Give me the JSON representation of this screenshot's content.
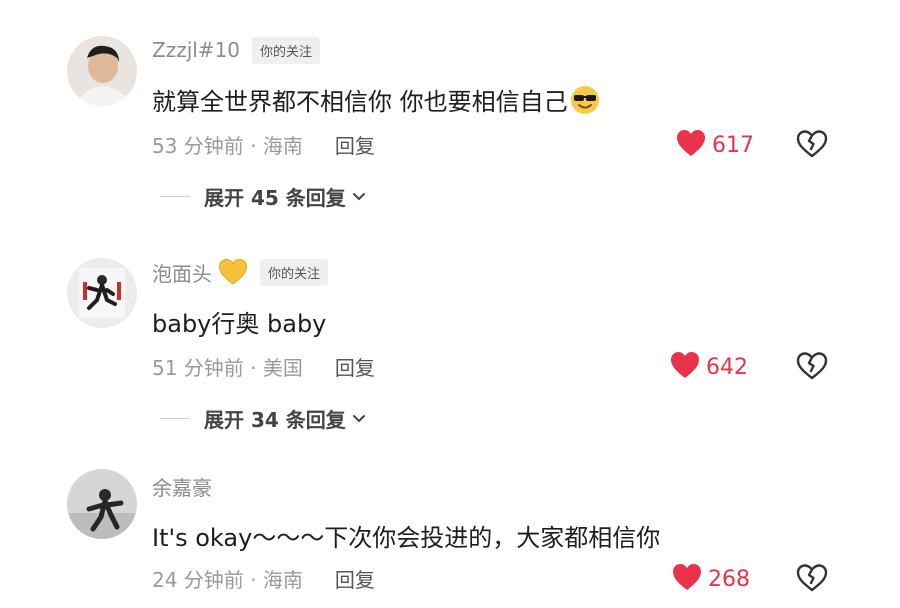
{
  "comments": [
    {
      "username": "Zzzjl#10",
      "badge": "你的关注",
      "text": "就算全世界都不相信你 你也要相信自己",
      "time_location": "53 分钟前 · 海南",
      "reply_label": "回复",
      "likes": "617",
      "expand_label": "展开 45 条回复",
      "emoji_icon": "sunglasses-emoji-icon"
    },
    {
      "username": "泡面头",
      "badge": "你的关注",
      "text": "baby行奥 baby",
      "time_location": "51 分钟前 · 美国",
      "reply_label": "回复",
      "likes": "642",
      "expand_label": "展开 34 条回复",
      "name_icon": "yellow-heart-icon"
    },
    {
      "username": "余嘉豪",
      "text": "It's okay～～～下次你会投进的，大家都相信你",
      "time_location": "24 分钟前 · 海南",
      "reply_label": "回复",
      "likes": "268"
    }
  ],
  "colors": {
    "like_red": "#e8334a",
    "meta_gray": "#9a9a9a",
    "badge_bg": "#efefef"
  }
}
